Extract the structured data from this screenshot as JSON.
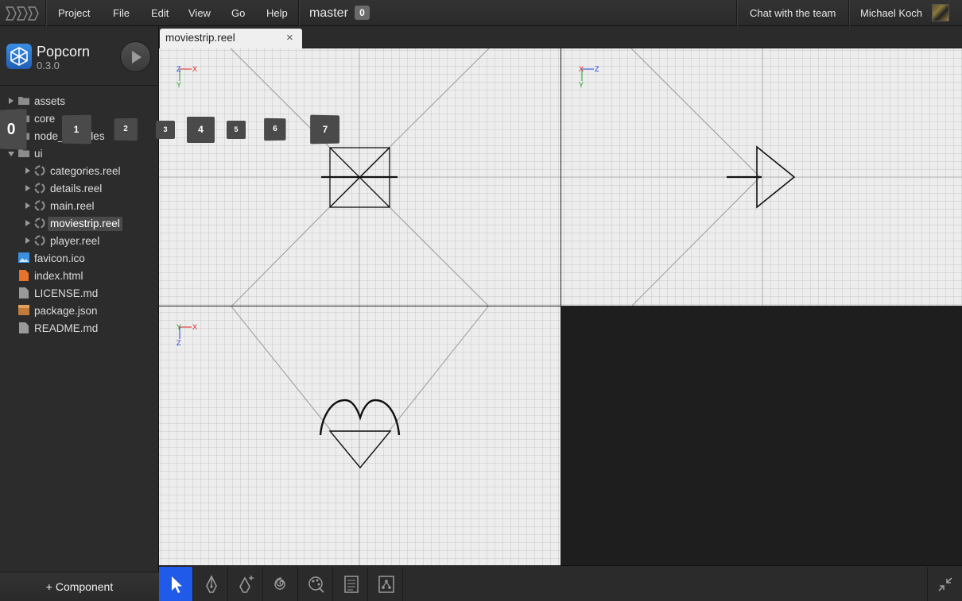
{
  "menu": {
    "project": "Project",
    "file": "File",
    "edit": "Edit",
    "view": "View",
    "go": "Go",
    "help": "Help",
    "branch": "master",
    "branch_count": "0",
    "chat": "Chat with the team",
    "user": "Michael Koch"
  },
  "project": {
    "name": "Popcorn",
    "version": "0.3.0"
  },
  "tree": {
    "assets": "assets",
    "core": "core",
    "node_modules": "node_modules",
    "ui": "ui",
    "categories": "categories.reel",
    "details": "details.reel",
    "main": "main.reel",
    "moviestrip": "moviestrip.reel",
    "player": "player.reel",
    "favicon": "favicon.ico",
    "index": "index.html",
    "license": "LICENSE.md",
    "package": "package.json",
    "readme": "README.md"
  },
  "add_component": "+ Component",
  "tab": {
    "label": "moviestrip.reel",
    "close": "×"
  },
  "axes": {
    "front": {
      "h": "X",
      "v": "Y",
      "corner": "Z"
    },
    "side": {
      "h": "Z",
      "v": "Y",
      "corner": "X"
    },
    "top": {
      "h": "X",
      "v": "Z",
      "corner": "Y"
    }
  },
  "preview_tiles": [
    "0",
    "1",
    "2",
    "3",
    "4",
    "5",
    "6",
    "7"
  ],
  "colors": {
    "accent": "#1f5be8",
    "axis_x": "#e02020",
    "axis_y": "#20a020",
    "axis_z": "#2040e0"
  }
}
